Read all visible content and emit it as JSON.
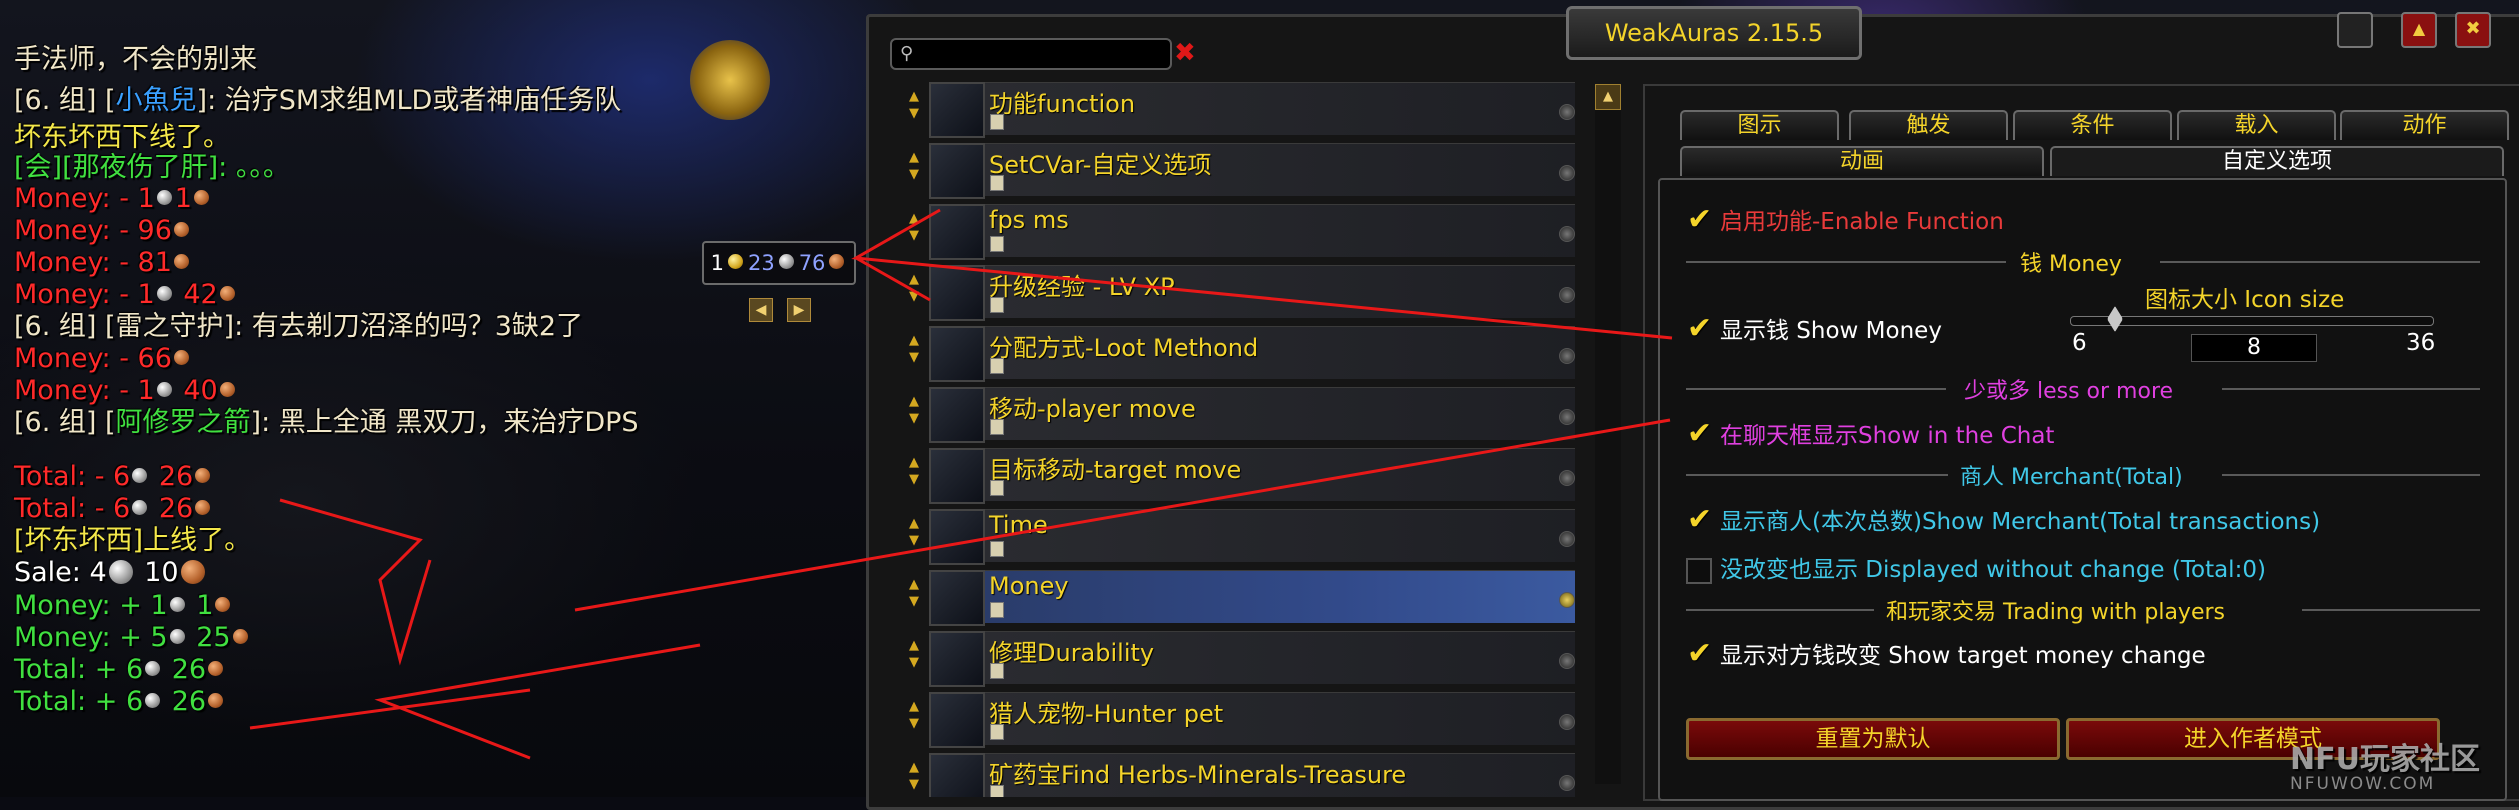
{
  "chat": {
    "lines": [
      {
        "parts": [
          {
            "t": "手法师，不会的别来",
            "c": "#f0e6c8"
          }
        ]
      },
      {
        "parts": [
          {
            "t": "[6. 组] [",
            "c": "#f0e6c8"
          },
          {
            "t": "小魚兒",
            "c": "#3aa0ff"
          },
          {
            "t": "]: 治疗SM求组MLD或者神庙任务队",
            "c": "#f0e6c8"
          }
        ]
      },
      {
        "parts": [
          {
            "t": "坏东坏西下线了。",
            "c": "#f4e84a"
          }
        ]
      },
      {
        "parts": [
          {
            "t": "[会][那夜伤了肝]: 。。。",
            "c": "#40e040"
          }
        ]
      },
      {
        "money": "Money: - 1",
        "c": "#ff2a2a",
        "coins": [
          {
            "v": "1",
            "k": "s"
          },
          {
            "v": "1",
            "k": "c"
          }
        ],
        "label": "Money: - ",
        "vals": [
          "1",
          "1"
        ]
      },
      {
        "parts": [
          {
            "t": "Money: - 96",
            "c": "#ff2a2a"
          }
        ],
        "coins": [
          "c"
        ]
      },
      {
        "parts": [
          {
            "t": "Money: - 81",
            "c": "#ff2a2a"
          }
        ],
        "coins": [
          "c"
        ]
      },
      {
        "parts": [
          {
            "t": "Money: - 1",
            "c": "#ff2a2a"
          },
          {
            "coin": "s"
          },
          {
            "t": " 42",
            "c": "#ff2a2a"
          }
        ],
        "coins": [
          "c"
        ]
      },
      {
        "parts": [
          {
            "t": "[6. 组] [",
            "c": "#f0e6c8"
          },
          {
            "t": "雷之守护",
            "c": "#f0e6c8"
          },
          {
            "t": "]: 有去剃刀沼泽的吗？3缺2了",
            "c": "#f0e6c8"
          }
        ]
      },
      {
        "parts": [
          {
            "t": "Money: - 66",
            "c": "#ff2a2a"
          }
        ],
        "coins": [
          "c"
        ]
      },
      {
        "parts": [
          {
            "t": "Money: - 1",
            "c": "#ff2a2a"
          },
          {
            "coin": "s"
          },
          {
            "t": " 40",
            "c": "#ff2a2a"
          }
        ],
        "coins": [
          "c"
        ]
      },
      {
        "parts": [
          {
            "t": "[6. 组] [",
            "c": "#f0e6c8"
          },
          {
            "t": "阿修罗之箭",
            "c": "#40e040"
          },
          {
            "t": "]: 黑上全通  黑双刀，来治疗DPS",
            "c": "#f0e6c8"
          }
        ]
      },
      {
        "parts": [
          {
            "t": "Total: - 6",
            "c": "#ff2a2a"
          },
          {
            "coin": "s"
          },
          {
            "t": " 26",
            "c": "#ff2a2a"
          }
        ],
        "coins": [
          "c"
        ]
      },
      {
        "parts": [
          {
            "t": "Total: - 6",
            "c": "#ff2a2a"
          },
          {
            "coin": "s"
          },
          {
            "t": " 26",
            "c": "#ff2a2a"
          }
        ],
        "coins": [
          "c"
        ]
      },
      {
        "parts": [
          {
            "t": "[坏东坏西]上线了。",
            "c": "#f4e84a"
          }
        ]
      },
      {
        "parts": [
          {
            "t": "Sale: 4",
            "c": "#ffffff"
          },
          {
            "coin": "sb"
          },
          {
            "t": " 10",
            "c": "#ffffff"
          }
        ],
        "coins": [
          "cb"
        ]
      },
      {
        "parts": [
          {
            "t": "Money: + 1",
            "c": "#40e040"
          },
          {
            "coin": "s"
          },
          {
            "t": " 1",
            "c": "#40e040"
          }
        ],
        "coins": [
          "c"
        ]
      },
      {
        "parts": [
          {
            "t": "Money: + 5",
            "c": "#40e040"
          },
          {
            "coin": "s"
          },
          {
            "t": " 25",
            "c": "#40e040"
          }
        ],
        "coins": [
          "c"
        ]
      },
      {
        "parts": [
          {
            "t": "Total: + 6",
            "c": "#40e040"
          },
          {
            "coin": "s"
          },
          {
            "t": " 26",
            "c": "#40e040"
          }
        ],
        "coins": [
          "c"
        ]
      },
      {
        "parts": [
          {
            "t": "Total: + 6",
            "c": "#40e040"
          },
          {
            "coin": "s"
          },
          {
            "t": " 26",
            "c": "#40e040"
          }
        ],
        "coins": [
          "c"
        ]
      }
    ]
  },
  "widget": {
    "gold": "1",
    "silver": "23",
    "copper": "76",
    "prev": "◀",
    "next": "▶"
  },
  "window": {
    "title": "WeakAuras 2.15.5",
    "collapse_glyph": "▲",
    "close_glyph": "✖",
    "search": {
      "placeholder": "",
      "clear_glyph": "✖"
    },
    "scroll_up": "▲"
  },
  "auras": [
    {
      "name": "功能function"
    },
    {
      "name": "SetCVar-自定义选项"
    },
    {
      "name": "fps ms"
    },
    {
      "name": "升级经验 - LV XP"
    },
    {
      "name": "分配方式-Loot Methond"
    },
    {
      "name": "移动-player move"
    },
    {
      "name": "目标移动-target move"
    },
    {
      "name": "Time"
    },
    {
      "name": "Money",
      "selected": true
    },
    {
      "name": "修理Durability"
    },
    {
      "name": "猎人宠物-Hunter pet"
    },
    {
      "name": "矿药宝Find Herbs-Minerals-Treasure"
    }
  ],
  "tabs_row1": [
    "图示",
    "触发",
    "条件",
    "载入",
    "动作"
  ],
  "tabs_row2": [
    "动画",
    "自定义选项"
  ],
  "options": {
    "enable": "启用功能-Enable Function",
    "sec_money": "钱 Money",
    "show_money": "显示钱 Show Money",
    "icon_size_label": "图标大小 Icon size",
    "icon_min": "6",
    "icon_value": "8",
    "icon_max": "36",
    "less_more": "少或多 less or more",
    "show_chat": "在聊天框显示Show in the Chat",
    "sec_merchant": "商人 Merchant(Total)",
    "show_merchant": "显示商人(本次总数)Show Merchant(Total transactions)",
    "no_change": "没改变也显示 Displayed without change (Total:0)",
    "sec_trade": "和玩家交易 Trading with players",
    "show_target": "显示对方钱改变 Show target money change"
  },
  "buttons": {
    "reset": "重置为默认",
    "author_mode": "进入作者模式"
  },
  "watermark": {
    "main": "NFU玩家社区",
    "sub": "NFUWOW.COM"
  },
  "colors": {
    "gold_text": "#f4d42a",
    "red_option": "#e83a3a",
    "magenta": "#e040e0",
    "cyan": "#40c8e8",
    "white": "#ffffff"
  }
}
